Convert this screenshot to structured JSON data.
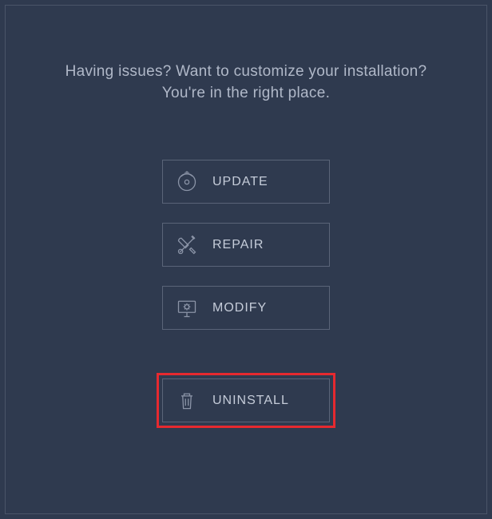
{
  "header": {
    "line1": "Having issues? Want to customize your installation?",
    "line2": "You're in the right place."
  },
  "buttons": {
    "update": {
      "label": "UPDATE",
      "icon": "refresh-disc-icon"
    },
    "repair": {
      "label": "REPAIR",
      "icon": "tools-icon"
    },
    "modify": {
      "label": "MODIFY",
      "icon": "monitor-gear-icon"
    },
    "uninstall": {
      "label": "UNINSTALL",
      "icon": "trash-icon",
      "highlighted": true
    }
  },
  "colors": {
    "background": "#2f3a4f",
    "border": "#5a6478",
    "text": "#b0b8c8",
    "highlight": "#e6292f"
  }
}
